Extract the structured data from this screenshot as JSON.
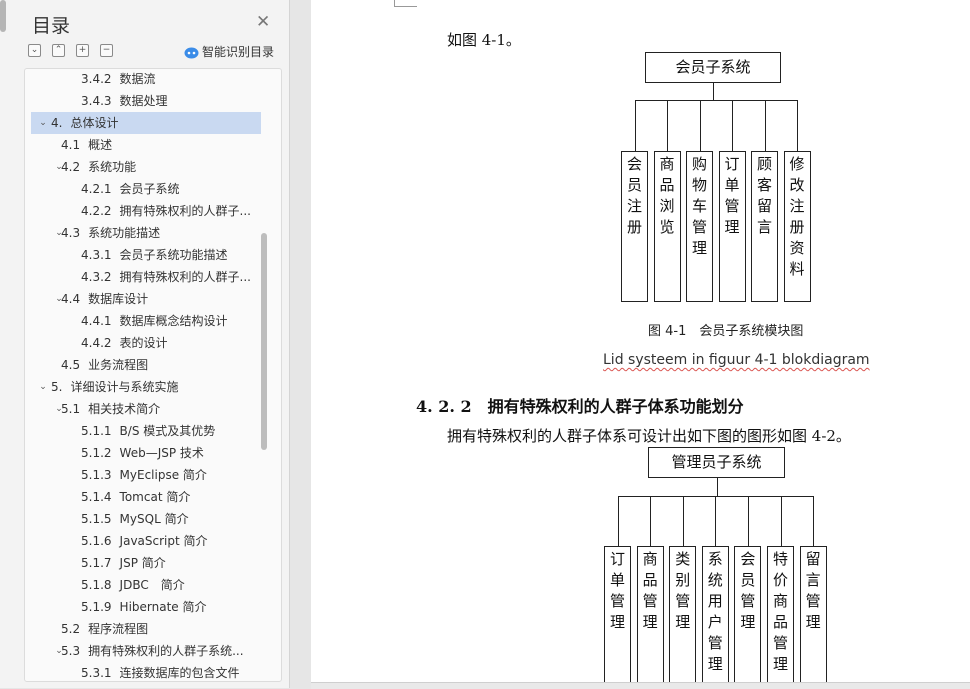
{
  "toc": {
    "title": "目录",
    "close_icon": "close-icon",
    "toolbar": {
      "collapse_all": "⌄",
      "expand_all": "⌃",
      "add": "+",
      "remove": "−",
      "smart_label": "智能识别目录"
    },
    "items": [
      {
        "num": "3.4.2",
        "label": "数据流",
        "level": 3
      },
      {
        "num": "3.4.3",
        "label": "数据处理",
        "level": 3
      },
      {
        "num": "4.",
        "label": "总体设计",
        "level": 1,
        "expanded": true,
        "selected": true
      },
      {
        "num": "4.1",
        "label": "概述",
        "level": 2
      },
      {
        "num": "4.2",
        "label": "系统功能",
        "level": 2,
        "expanded": true
      },
      {
        "num": "4.2.1",
        "label": "会员子系统",
        "level": 3
      },
      {
        "num": "4.2.2",
        "label": "拥有特殊权利的人群子...",
        "level": 3
      },
      {
        "num": "4.3",
        "label": "系统功能描述",
        "level": 2,
        "expanded": true
      },
      {
        "num": "4.3.1",
        "label": "会员子系统功能描述",
        "level": 3
      },
      {
        "num": "4.3.2",
        "label": "拥有特殊权利的人群子...",
        "level": 3
      },
      {
        "num": "4.4",
        "label": "数据库设计",
        "level": 2,
        "expanded": true
      },
      {
        "num": "4.4.1",
        "label": "数据库概念结构设计",
        "level": 3
      },
      {
        "num": "4.4.2",
        "label": "表的设计",
        "level": 3
      },
      {
        "num": "4.5",
        "label": "业务流程图",
        "level": 2
      },
      {
        "num": "5.",
        "label": "详细设计与系统实施",
        "level": 1,
        "expanded": true
      },
      {
        "num": "5.1",
        "label": "相关技术简介",
        "level": 2,
        "expanded": true
      },
      {
        "num": "5.1.1",
        "label": "B/S 模式及其优势",
        "level": 3
      },
      {
        "num": "5.1.2",
        "label": "Web—JSP 技术",
        "level": 3
      },
      {
        "num": "5.1.3",
        "label": "MyEclipse 简介",
        "level": 3
      },
      {
        "num": "5.1.4",
        "label": "Tomcat 简介",
        "level": 3
      },
      {
        "num": "5.1.5",
        "label": "MySQL 简介",
        "level": 3
      },
      {
        "num": "5.1.6",
        "label": "JavaScript 简介",
        "level": 3
      },
      {
        "num": "5.1.7",
        "label": "JSP 简介",
        "level": 3
      },
      {
        "num": "5.1.8",
        "label": "JDBC　简介",
        "level": 3
      },
      {
        "num": "5.1.9",
        "label": "Hibernate 简介",
        "level": 3
      },
      {
        "num": "5.2",
        "label": "程序流程图",
        "level": 2
      },
      {
        "num": "5.3",
        "label": "拥有特殊权利的人群子系统...",
        "level": 2,
        "expanded": true
      },
      {
        "num": "5.3.1",
        "label": "连接数据库的包含文件",
        "level": 3
      }
    ]
  },
  "doc": {
    "intro_line": "如图 4-1。",
    "diagram1": {
      "root": "会员子系统",
      "leaves": [
        "会员注册",
        "商品浏览",
        "购物车管理",
        "订单管理",
        "顾客留言",
        "修改注册资料"
      ]
    },
    "caption1": "图 4-1　会员子系统模块图",
    "translation1": "Lid systeem in figuur 4-1 blokdiagram",
    "heading": "4. 2. 2　拥有特殊权利的人群子体系功能划分",
    "para": "拥有特殊权利的人群子体系可设计出如下图的图形如图 4-2。",
    "diagram2": {
      "root": "管理员子系统",
      "leaves": [
        "订单管理",
        "商品管理",
        "类别管理",
        "系统用户管理",
        "会员管理",
        "特价商品管理",
        "留言管理"
      ]
    }
  }
}
